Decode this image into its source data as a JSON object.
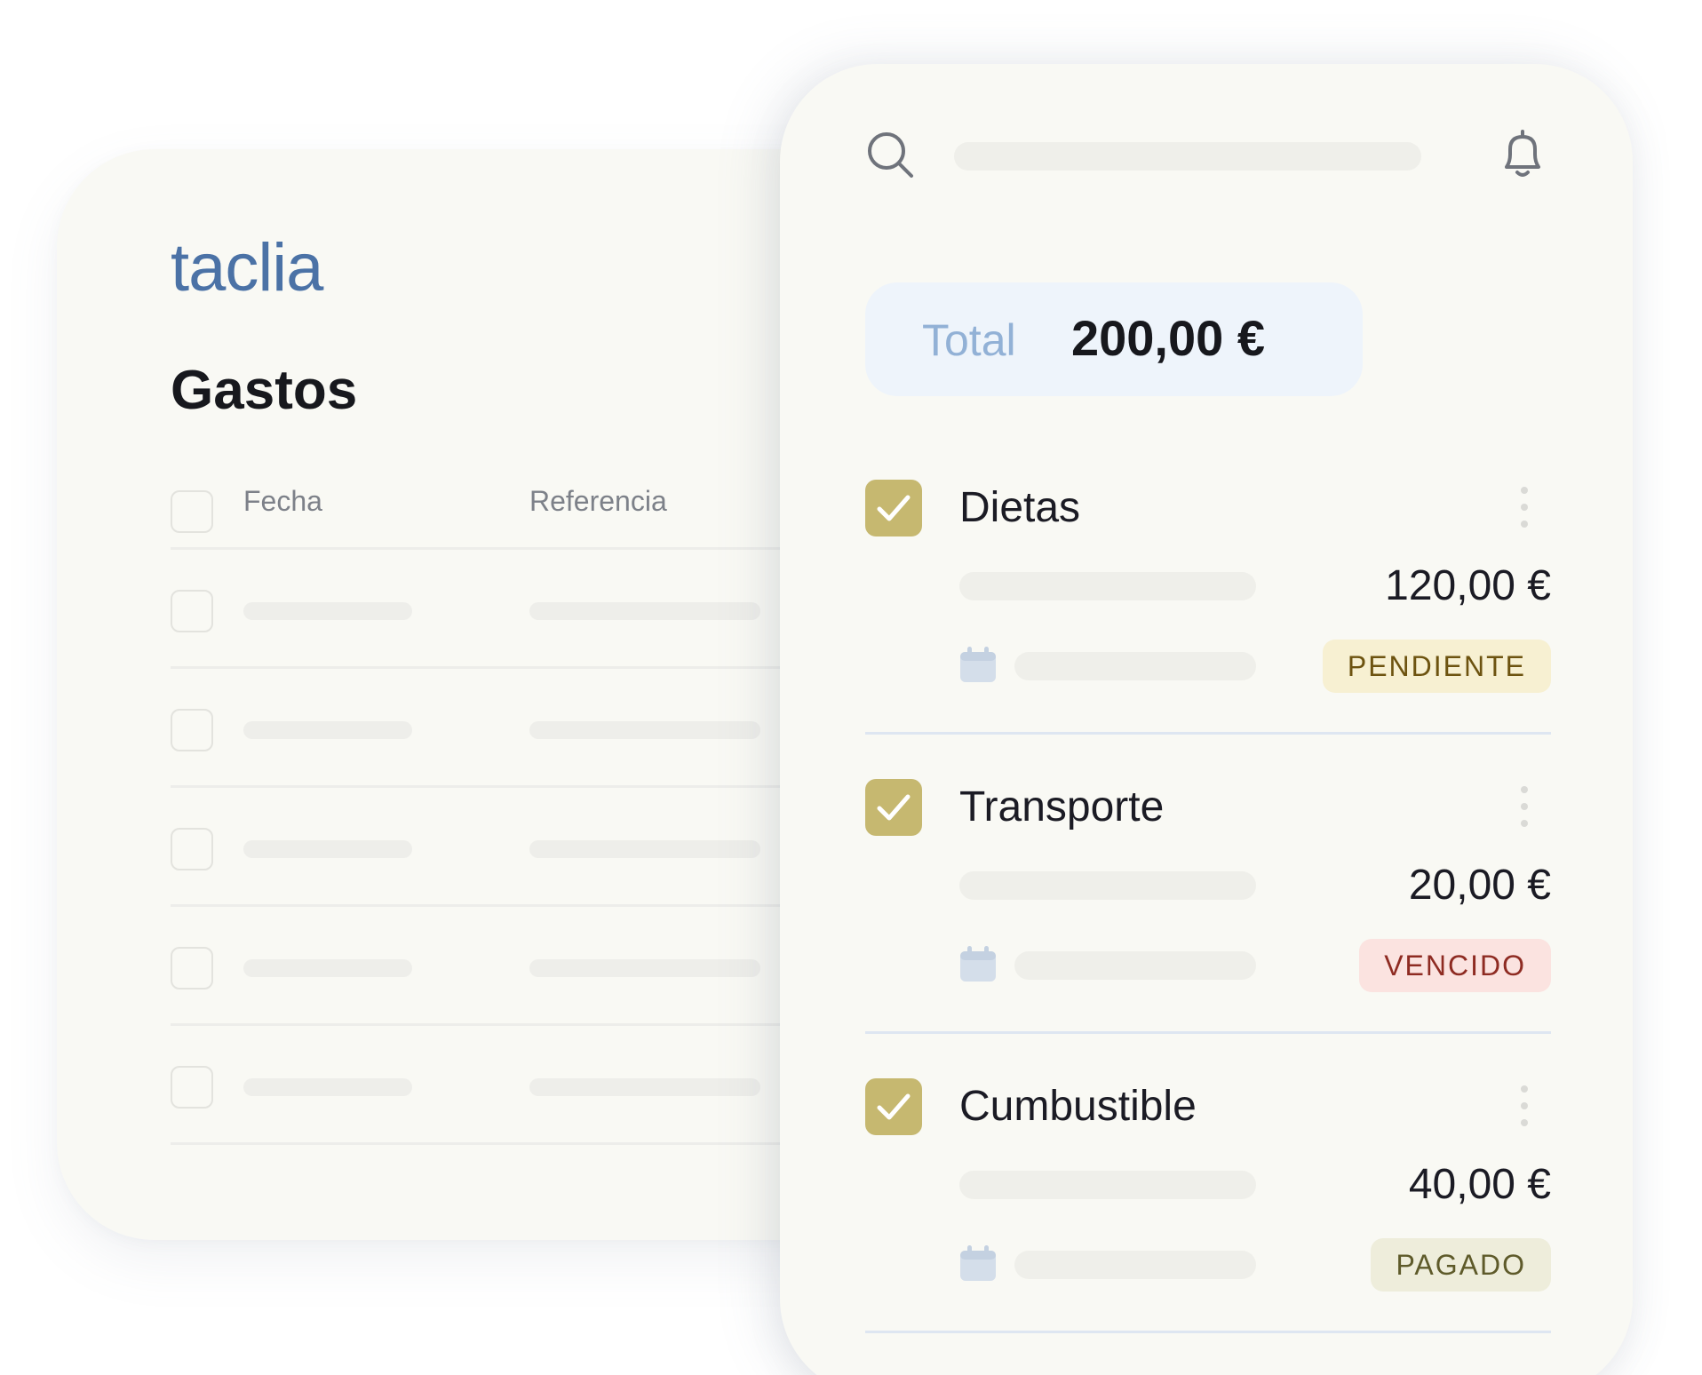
{
  "app": {
    "logo": "taclia"
  },
  "expenses_page": {
    "title": "Gastos",
    "columns": [
      "Fecha",
      "Referencia"
    ],
    "row_count": 5
  },
  "mobile": {
    "search": {
      "icon": "search-icon"
    },
    "notifications": {
      "icon": "bell-icon"
    },
    "total": {
      "label": "Total",
      "value": "200,00 €"
    },
    "expenses": [
      {
        "name": "Dietas",
        "amount": "120,00 €",
        "status": "PENDIENTE",
        "checked": true
      },
      {
        "name": "Transporte",
        "amount": "20,00 €",
        "status": "VENCIDO",
        "checked": true
      },
      {
        "name": "Cumbustible",
        "amount": "40,00 €",
        "status": "PAGADO",
        "checked": true
      }
    ]
  },
  "colors": {
    "brand": "#4b72a6",
    "check": "#c6b870",
    "pendiente_bg": "#f7f0d2",
    "pendiente_text": "#6d5310",
    "vencido_bg": "#fbe3e0",
    "vencido_text": "#8e2b22",
    "pagado_bg": "#eeeddb",
    "pagado_text": "#5e5a2a"
  }
}
